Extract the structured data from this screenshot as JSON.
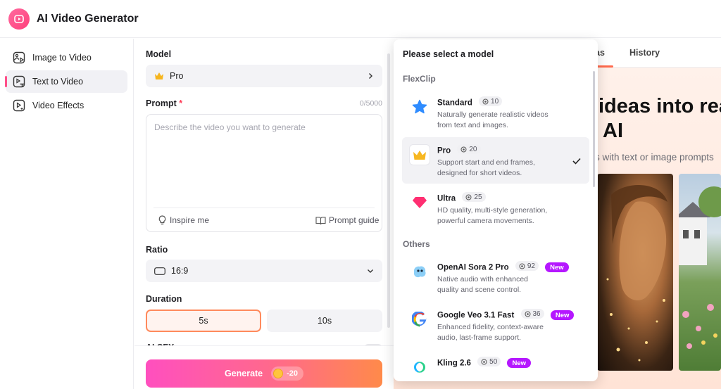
{
  "app": {
    "title": "AI Video Generator"
  },
  "sidebar": {
    "items": [
      {
        "label": "Image to Video",
        "icon": "image-video-icon",
        "active": false
      },
      {
        "label": "Text to Video",
        "icon": "text-video-icon",
        "active": true
      },
      {
        "label": "Video Effects",
        "icon": "video-effects-icon",
        "active": false
      }
    ]
  },
  "form": {
    "model_label": "Model",
    "model_value": "Pro",
    "prompt_label": "Prompt",
    "prompt_required": "*",
    "prompt_counter": "0/5000",
    "prompt_placeholder": "Describe the video you want to generate",
    "inspire_label": "Inspire me",
    "guide_label": "Prompt guide",
    "ratio_label": "Ratio",
    "ratio_value": "16:9",
    "duration_label": "Duration",
    "duration_options": [
      "5s",
      "10s"
    ],
    "duration_selected": "5s",
    "alsfx_label": "AI SFX",
    "generate_label": "Generate",
    "generate_cost": "-20"
  },
  "gallery": {
    "tabs": [
      "Ideas",
      "History"
    ],
    "tab_visible_fragment": "as",
    "hero_line1": "ideas into rea",
    "hero_line2": "AI",
    "hero_sub": "s with text or image prompts"
  },
  "dropdown": {
    "title": "Please select a model",
    "sections": [
      {
        "label": "FlexClip",
        "models": [
          {
            "name": "Standard",
            "credits": "10",
            "desc": "Naturally generate realistic videos from text and images.",
            "icon": "star-icon",
            "selected": false,
            "is_new": false
          },
          {
            "name": "Pro",
            "credits": "20",
            "desc": "Support start and end frames, designed for short videos.",
            "icon": "crown-icon",
            "selected": true,
            "is_new": false
          },
          {
            "name": "Ultra",
            "credits": "25",
            "desc": "HD quality, multi-style generation, powerful camera movements.",
            "icon": "diamond-icon",
            "selected": false,
            "is_new": false
          }
        ]
      },
      {
        "label": "Others",
        "models": [
          {
            "name": "OpenAI Sora 2 Pro",
            "credits": "92",
            "desc": "Native audio with enhanced quality and scene control.",
            "icon": "sora-icon",
            "selected": false,
            "is_new": true
          },
          {
            "name": "Google Veo 3.1 Fast",
            "credits": "36",
            "desc": "Enhanced fidelity, context-aware audio, last-frame support.",
            "icon": "google-icon",
            "selected": false,
            "is_new": true
          },
          {
            "name": "Kling 2.6",
            "credits": "50",
            "desc": "",
            "icon": "kling-icon",
            "selected": false,
            "is_new": true
          }
        ]
      }
    ],
    "new_badge": "New"
  },
  "colors": {
    "accent": "#ff4f8a",
    "generate_gradient_start": "#ff4fbf",
    "generate_gradient_end": "#ff8a4a",
    "new_badge": "#b517ff",
    "selected_duration_border": "#ff8a5c"
  }
}
